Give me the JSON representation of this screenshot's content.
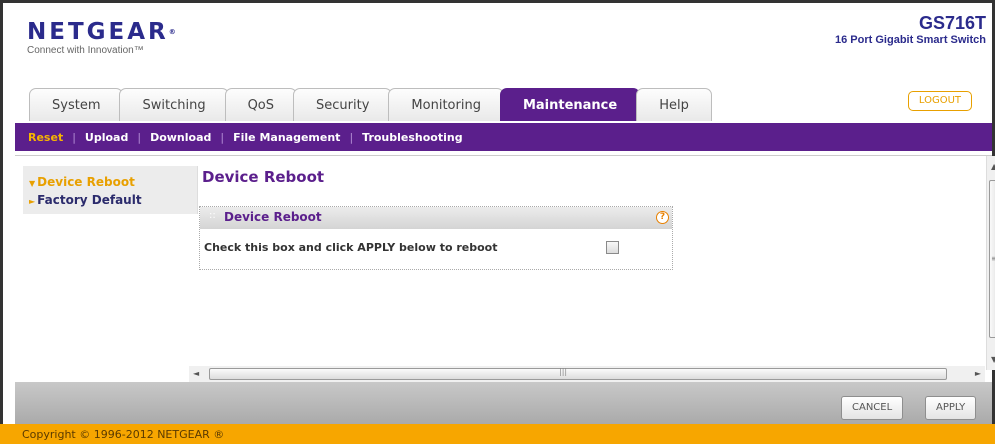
{
  "header": {
    "brand": "NETGEAR",
    "brand_mark": "®",
    "tagline": "Connect with Innovation™",
    "model": "GS716T",
    "model_desc": "16 Port Gigabit Smart Switch"
  },
  "tabs": [
    {
      "label": "System",
      "active": false
    },
    {
      "label": "Switching",
      "active": false
    },
    {
      "label": "QoS",
      "active": false
    },
    {
      "label": "Security",
      "active": false
    },
    {
      "label": "Monitoring",
      "active": false
    },
    {
      "label": "Maintenance",
      "active": true
    },
    {
      "label": "Help",
      "active": false
    }
  ],
  "logout_label": "LOGOUT",
  "subnav": [
    {
      "label": "Reset",
      "active": true
    },
    {
      "label": "Upload",
      "active": false
    },
    {
      "label": "Download",
      "active": false
    },
    {
      "label": "File Management",
      "active": false
    },
    {
      "label": "Troubleshooting",
      "active": false
    }
  ],
  "leftnav": [
    {
      "label": "Device Reboot",
      "active": true
    },
    {
      "label": "Factory Default",
      "active": false
    }
  ],
  "page_title": "Device Reboot",
  "panel": {
    "title": "Device Reboot",
    "help_symbol": "?",
    "reboot_label": "Check this box and click APPLY below to reboot",
    "reboot_checked": false
  },
  "buttons": {
    "cancel": "CANCEL",
    "apply": "APPLY"
  },
  "copyright": "Copyright © 1996-2012 NETGEAR ®",
  "colors": {
    "primary_purple": "#5b1f8c",
    "brand_blue": "#2b2b8c",
    "accent_orange": "#e8a000",
    "footer_orange": "#f7a600"
  }
}
